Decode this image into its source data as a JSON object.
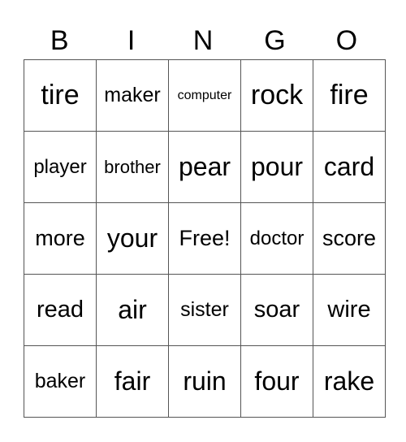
{
  "header": {
    "letters": [
      "B",
      "I",
      "N",
      "G",
      "O"
    ]
  },
  "card": {
    "rows": [
      [
        "tire",
        "maker",
        "computer",
        "rock",
        "fire"
      ],
      [
        "player",
        "brother",
        "pear",
        "pour",
        "card"
      ],
      [
        "more",
        "your",
        "Free!",
        "doctor",
        "score"
      ],
      [
        "read",
        "air",
        "sister",
        "soar",
        "wire"
      ],
      [
        "baker",
        "fair",
        "ruin",
        "four",
        "rake"
      ]
    ]
  }
}
